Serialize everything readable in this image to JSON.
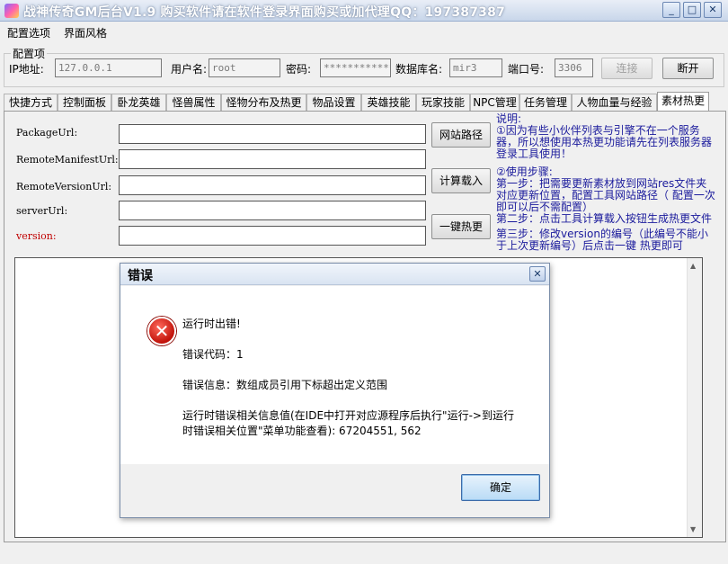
{
  "window": {
    "title": "战神传奇GM后台V1.9    购买软件请在软件登录界面购买或加代理QQ：197387387",
    "minimize": "_",
    "maximize": "□",
    "close": "✕"
  },
  "menu": [
    "配置选项",
    "界面风格"
  ],
  "config": {
    "group_title": "配置项",
    "ip_label": "IP地址:",
    "ip_value": "127.0.0.1",
    "user_label": "用户名:",
    "user_value": "root",
    "password_label": "密码:",
    "password_value": "*************",
    "db_label": "数据库名:",
    "db_value": "mir3",
    "port_label": "端口号:",
    "port_value": "3306",
    "connect_button": "连接",
    "disconnect_button": "断开"
  },
  "tabs": [
    "快捷方式",
    "控制面板",
    "卧龙英雄",
    "怪兽属性",
    "怪物分布及热更",
    "物品设置",
    "英雄技能",
    "玩家技能",
    "NPC管理",
    "任务管理",
    "人物血量与经验",
    "素材热更"
  ],
  "active_tab": "素材热更",
  "form": {
    "fields": [
      {
        "label": "PackageUrl:",
        "value": ""
      },
      {
        "label": "RemoteManifestUrl:",
        "value": ""
      },
      {
        "label": "RemoteVersionUrl:",
        "value": ""
      },
      {
        "label": "serverUrl:",
        "value": ""
      },
      {
        "label": "version:",
        "value": ""
      }
    ],
    "buttons": [
      "网站路径",
      "计算载入",
      "一键热更"
    ]
  },
  "notes": {
    "heading": "说明:",
    "line1": "①因为有些小伙伴列表与引擎不在一个服务器，所以想使用本热更功能请先在列表服务器登录工具使用！",
    "line2": "②使用步骤:",
    "step1": "    第一步：把需要更新素材放到网站res文件夹对应更新位置，配置工具网站路径（   配置一次即可以后不需配置）",
    "step2": "    第二步：点击工具计算载入按钮生成热更文件",
    "step3": "    第三步：修改version的编号（此编号不能小于上次更新编号）后点击一键   热更即可"
  },
  "dialog": {
    "title": "错误",
    "close": "✕",
    "icon_glyph": "✕",
    "line1": "运行时出错!",
    "line2": "错误代码：1",
    "line3": "错误信息：数组成员引用下标超出定义范围",
    "line4": "运行时错误相关信息值(在IDE中打开对应源程序后执行\"运行->到运行",
    "line5": "时错误相关位置\"菜单功能查看): 67204551, 562",
    "ok_button": "确定"
  },
  "scrollbar": {
    "up": "▲",
    "down": "▼"
  }
}
